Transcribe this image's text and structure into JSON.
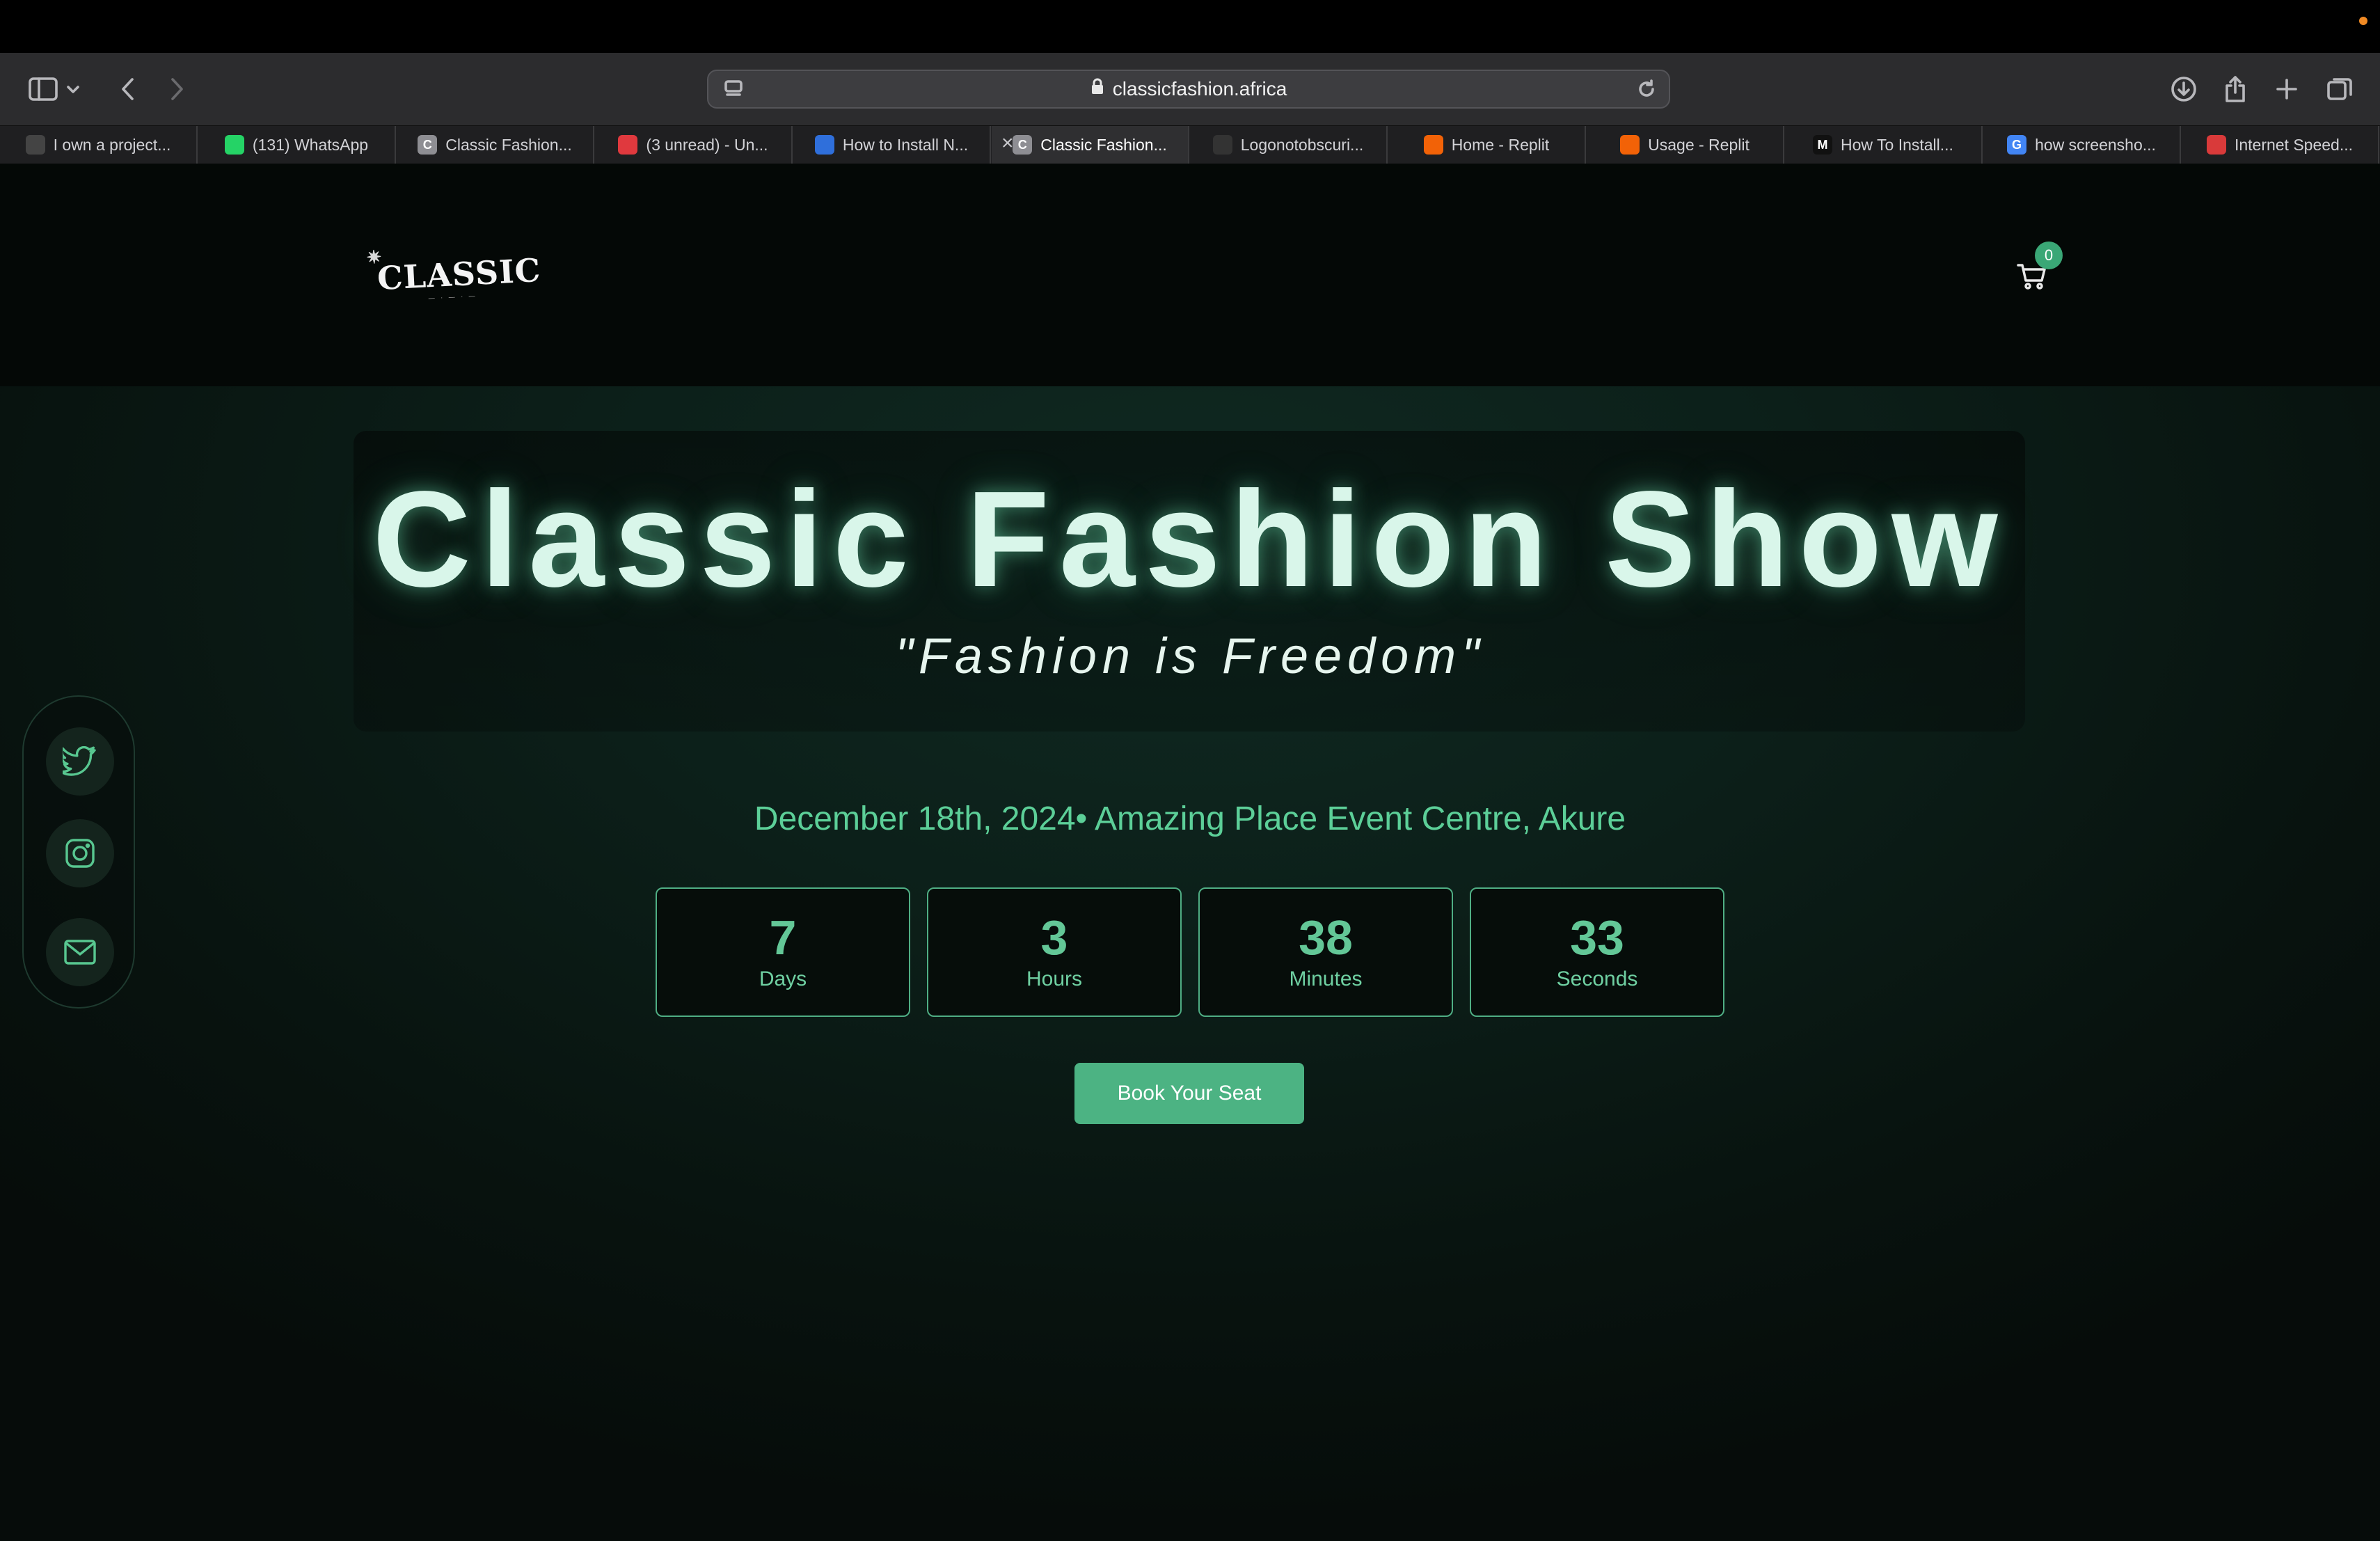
{
  "browser": {
    "url": "classicfashion.africa",
    "tabs": [
      {
        "label": "I own a project...",
        "favicon": "grid-icon",
        "color": "#444"
      },
      {
        "label": "(131) WhatsApp",
        "favicon": "whatsapp-icon",
        "color": "#25d366"
      },
      {
        "label": "Classic Fashion...",
        "favicon": "C",
        "color": "#8e8e93"
      },
      {
        "label": "(3 unread) - Un...",
        "favicon": "target-icon",
        "color": "#e0393e"
      },
      {
        "label": "How to Install N...",
        "favicon": "shape-icon",
        "color": "#2f6fdb"
      },
      {
        "label": "Classic Fashion...",
        "favicon": "C",
        "color": "#8e8e93",
        "active": true
      },
      {
        "label": "Logonotobscuri...",
        "favicon": "github-icon",
        "color": "#333"
      },
      {
        "label": "Home - Replit",
        "favicon": "replit-icon",
        "color": "#f26207"
      },
      {
        "label": "Usage - Replit",
        "favicon": "replit-icon",
        "color": "#f26207"
      },
      {
        "label": "How To Install...",
        "favicon": "M",
        "color": "#111"
      },
      {
        "label": "how screensho...",
        "favicon": "G",
        "color": "#4285f4"
      },
      {
        "label": "Internet Speed...",
        "favicon": "speed-icon",
        "color": "#d93a3a"
      }
    ]
  },
  "header": {
    "logo_text": "CLASSIC",
    "cart_count": "0"
  },
  "hero": {
    "title": "Classic Fashion Show",
    "tagline": "\"Fashion is Freedom\""
  },
  "event": {
    "details": "December 18th, 2024• Amazing Place Event Centre, Akure"
  },
  "countdown": [
    {
      "value": "7",
      "label": "Days"
    },
    {
      "value": "3",
      "label": "Hours"
    },
    {
      "value": "38",
      "label": "Minutes"
    },
    {
      "value": "33",
      "label": "Seconds"
    }
  ],
  "cta": {
    "label": "Book Your Seat"
  },
  "social": [
    "twitter-icon",
    "instagram-icon",
    "mail-icon"
  ],
  "colors": {
    "accent": "#4cb383",
    "accent_text": "#5ccf98",
    "title_glow": "#d9f6ea",
    "background": "#0c1f19"
  }
}
